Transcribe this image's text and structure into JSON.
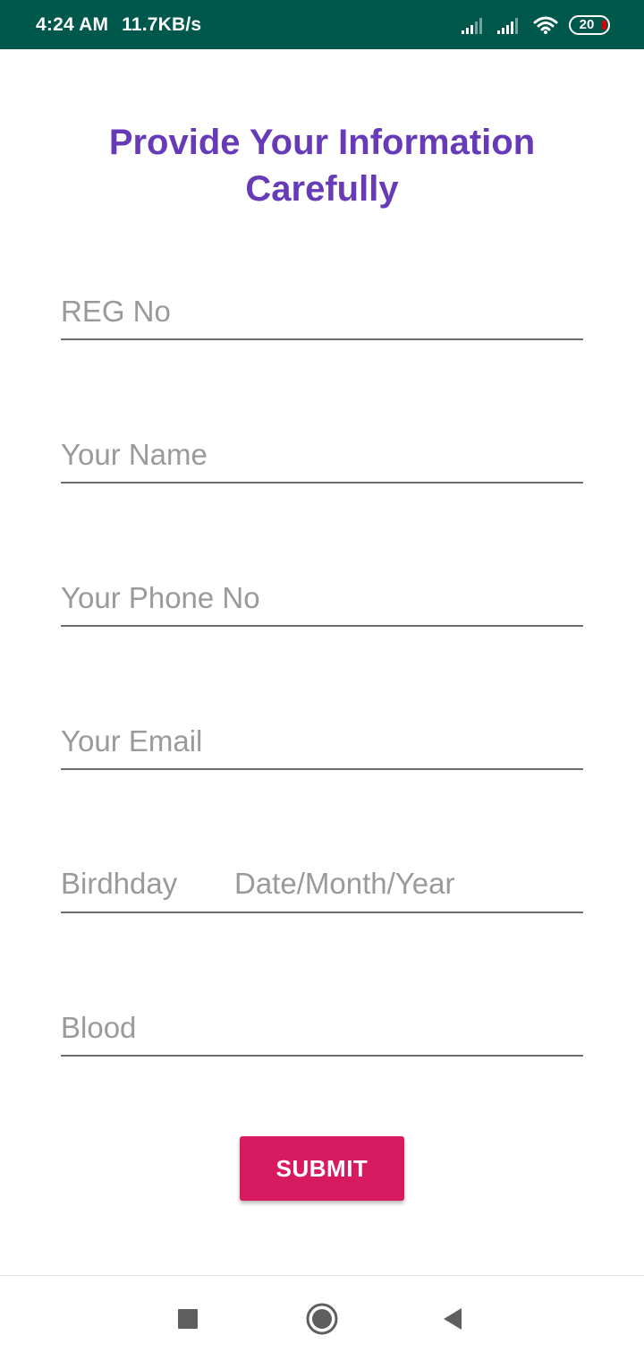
{
  "status_bar": {
    "time": "4:24 AM",
    "network_speed": "11.7KB/s",
    "battery_level": "20",
    "background_color": "#00574b"
  },
  "form": {
    "title_line1": "Provide Your Information",
    "title_line2": "Carefully",
    "title_color": "#673ab7",
    "fields": {
      "reg_no": {
        "placeholder": "REG No",
        "value": ""
      },
      "name": {
        "placeholder": "Your Name",
        "value": ""
      },
      "phone": {
        "placeholder": "Your Phone No",
        "value": ""
      },
      "email": {
        "placeholder": "Your Email",
        "value": ""
      },
      "birthday": {
        "label": "Birdhday",
        "placeholder": "Date/Month/Year"
      },
      "blood": {
        "placeholder": "Blood",
        "value": ""
      }
    },
    "submit_label": "SUBMIT",
    "submit_color": "#d81b60"
  },
  "nav_bar": {
    "recents_icon": "square-icon",
    "home_icon": "circle-icon",
    "back_icon": "triangle-back-icon"
  }
}
